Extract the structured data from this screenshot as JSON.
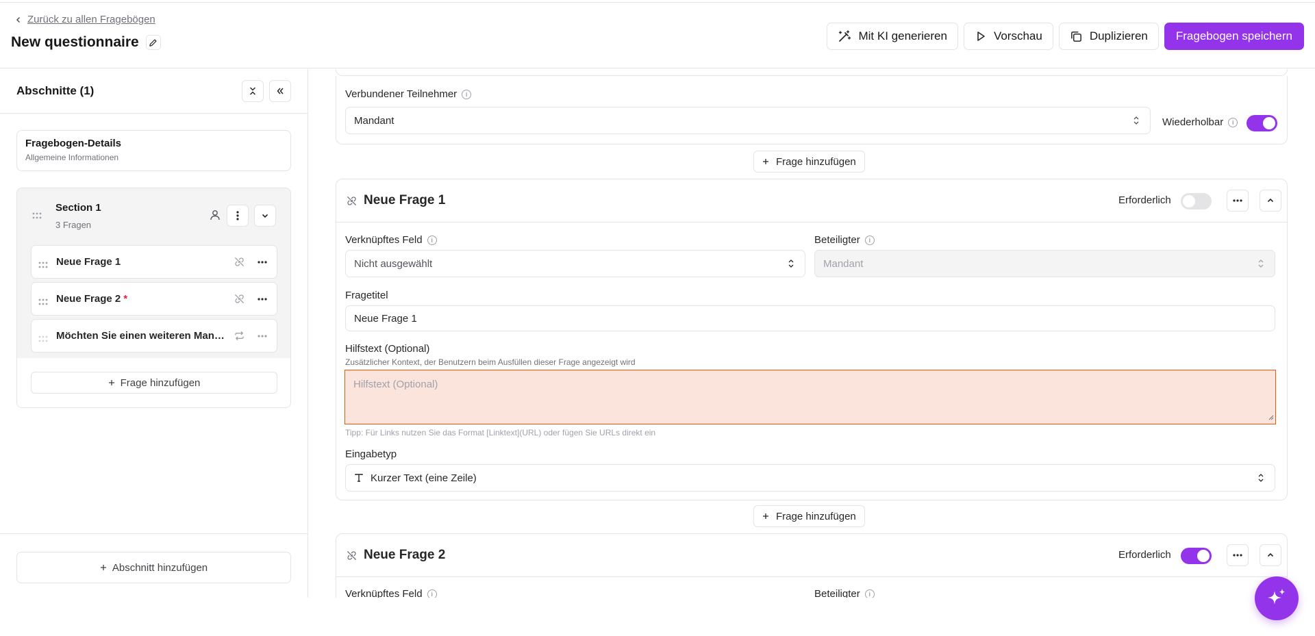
{
  "header": {
    "back_link": "Zurück zu allen Fragebögen",
    "title": "New questionnaire",
    "actions": {
      "generate": "Mit KI generieren",
      "preview": "Vorschau",
      "duplicate": "Duplizieren",
      "save": "Fragebogen speichern"
    }
  },
  "sidebar": {
    "title": "Abschnitte (1)",
    "details": {
      "title": "Fragebogen-Details",
      "subtitle": "Allgemeine Informationen"
    },
    "section": {
      "name": "Section 1",
      "count": "3 Fragen",
      "items": [
        {
          "label": "Neue Frage 1",
          "required": ""
        },
        {
          "label": "Neue Frage 2",
          "required": "*"
        },
        {
          "label": "Möchten Sie einen weiteren Mandanten hinzufügen?",
          "required": ""
        }
      ],
      "add_question": "Frage hinzufügen"
    },
    "add_section": "Abschnitt hinzufügen"
  },
  "main": {
    "top_card": {
      "participant_label": "Verbundener Teilnehmer",
      "participant_value": "Mandant",
      "repeatable_label": "Wiederholbar",
      "repeatable_on": true
    },
    "add_question": "Frage hinzufügen",
    "question1": {
      "title": "Neue Frage 1",
      "required_label": "Erforderlich",
      "required_on": false,
      "linked_field_label": "Verknüpftes Feld",
      "linked_field_value": "Nicht ausgewählt",
      "participant_label": "Beteiligter",
      "participant_value": "Mandant",
      "question_title_label": "Fragetitel",
      "question_title_value": "Neue Frage 1",
      "help_label": "Hilfstext (Optional)",
      "help_desc": "Zusätzlicher Kontext, der Benutzern beim Ausfüllen dieser Frage angezeigt wird",
      "help_placeholder": "Hilfstext (Optional)",
      "help_tip": "Tipp: Für Links nutzen Sie das Format [Linktext](URL) oder fügen Sie URLs direkt ein",
      "input_type_label": "Eingabetyp",
      "input_type_value": "Kurzer Text (eine Zeile)"
    },
    "question2": {
      "title": "Neue Frage 2",
      "required_label": "Erforderlich",
      "required_on": true,
      "linked_field_label": "Verknüpftes Feld",
      "participant_label": "Beteiligter"
    }
  },
  "colors": {
    "accent": "#9333ea",
    "error_border": "#ea580c",
    "error_bg": "#fbe4dc"
  }
}
